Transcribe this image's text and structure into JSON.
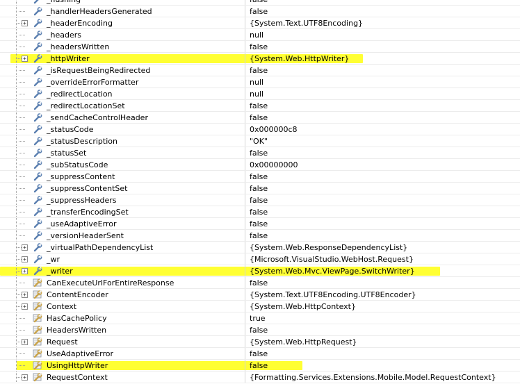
{
  "theme": {
    "highlight": "#ffff33",
    "icon": "wrench-icon"
  },
  "rows": [
    {
      "name": "_flushing",
      "value": "false",
      "expandable": false,
      "highlighted": false,
      "kind": "field"
    },
    {
      "name": "_handlerHeadersGenerated",
      "value": "false",
      "expandable": false,
      "highlighted": false,
      "kind": "field"
    },
    {
      "name": "_headerEncoding",
      "value": "{System.Text.UTF8Encoding}",
      "expandable": true,
      "highlighted": false,
      "kind": "field"
    },
    {
      "name": "_headers",
      "value": "null",
      "expandable": false,
      "highlighted": false,
      "kind": "field"
    },
    {
      "name": "_headersWritten",
      "value": "false",
      "expandable": false,
      "highlighted": false,
      "kind": "field"
    },
    {
      "name": "_httpWriter",
      "value": "{System.Web.HttpWriter}",
      "expandable": true,
      "highlighted": true,
      "kind": "field"
    },
    {
      "name": "_isRequestBeingRedirected",
      "value": "false",
      "expandable": false,
      "highlighted": false,
      "kind": "field"
    },
    {
      "name": "_overrideErrorFormatter",
      "value": "null",
      "expandable": false,
      "highlighted": false,
      "kind": "field"
    },
    {
      "name": "_redirectLocation",
      "value": "null",
      "expandable": false,
      "highlighted": false,
      "kind": "field"
    },
    {
      "name": "_redirectLocationSet",
      "value": "false",
      "expandable": false,
      "highlighted": false,
      "kind": "field"
    },
    {
      "name": "_sendCacheControlHeader",
      "value": "false",
      "expandable": false,
      "highlighted": false,
      "kind": "field"
    },
    {
      "name": "_statusCode",
      "value": "0x000000c8",
      "expandable": false,
      "highlighted": false,
      "kind": "field"
    },
    {
      "name": "_statusDescription",
      "value": "\"OK\"",
      "expandable": false,
      "highlighted": false,
      "kind": "field"
    },
    {
      "name": "_statusSet",
      "value": "false",
      "expandable": false,
      "highlighted": false,
      "kind": "field"
    },
    {
      "name": "_subStatusCode",
      "value": "0x00000000",
      "expandable": false,
      "highlighted": false,
      "kind": "field"
    },
    {
      "name": "_suppressContent",
      "value": "false",
      "expandable": false,
      "highlighted": false,
      "kind": "field"
    },
    {
      "name": "_suppressContentSet",
      "value": "false",
      "expandable": false,
      "highlighted": false,
      "kind": "field"
    },
    {
      "name": "_suppressHeaders",
      "value": "false",
      "expandable": false,
      "highlighted": false,
      "kind": "field"
    },
    {
      "name": "_transferEncodingSet",
      "value": "false",
      "expandable": false,
      "highlighted": false,
      "kind": "field"
    },
    {
      "name": "_useAdaptiveError",
      "value": "false",
      "expandable": false,
      "highlighted": false,
      "kind": "field"
    },
    {
      "name": "_versionHeaderSent",
      "value": "false",
      "expandable": false,
      "highlighted": false,
      "kind": "field"
    },
    {
      "name": "_virtualPathDependencyList",
      "value": "{System.Web.ResponseDependencyList}",
      "expandable": true,
      "highlighted": false,
      "kind": "field"
    },
    {
      "name": "_wr",
      "value": "{Microsoft.VisualStudio.WebHost.Request}",
      "expandable": true,
      "highlighted": false,
      "kind": "field"
    },
    {
      "name": "_writer",
      "value": "{System.Web.Mvc.ViewPage.SwitchWriter}",
      "expandable": true,
      "highlighted": true,
      "kind": "field"
    },
    {
      "name": "CanExecuteUrlForEntireResponse",
      "value": "false",
      "expandable": false,
      "highlighted": false,
      "kind": "property"
    },
    {
      "name": "ContentEncoder",
      "value": "{System.Text.UTF8Encoding.UTF8Encoder}",
      "expandable": true,
      "highlighted": false,
      "kind": "property"
    },
    {
      "name": "Context",
      "value": "{System.Web.HttpContext}",
      "expandable": true,
      "highlighted": false,
      "kind": "property"
    },
    {
      "name": "HasCachePolicy",
      "value": "true",
      "expandable": false,
      "highlighted": false,
      "kind": "property"
    },
    {
      "name": "HeadersWritten",
      "value": "false",
      "expandable": false,
      "highlighted": false,
      "kind": "property"
    },
    {
      "name": "Request",
      "value": "{System.Web.HttpRequest}",
      "expandable": true,
      "highlighted": false,
      "kind": "property"
    },
    {
      "name": "UseAdaptiveError",
      "value": "false",
      "expandable": false,
      "highlighted": false,
      "kind": "property"
    },
    {
      "name": "UsingHttpWriter",
      "value": "false",
      "expandable": false,
      "highlighted": true,
      "kind": "property"
    },
    {
      "name": "RequestContext",
      "value": "{Formatting.Services.Extensions.Mobile.Model.RequestContext}",
      "expandable": true,
      "highlighted": false,
      "kind": "property"
    }
  ]
}
